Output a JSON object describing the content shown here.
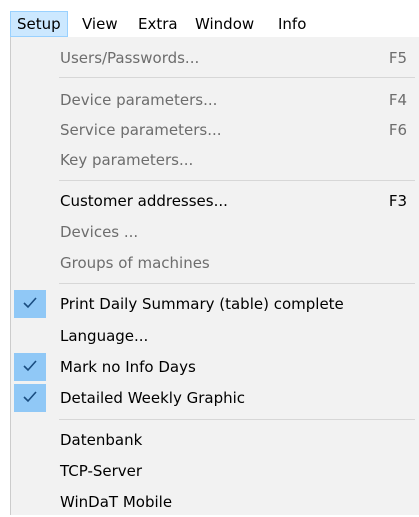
{
  "menubar": {
    "items": [
      "Setup",
      "View",
      "Extra",
      "Window",
      "Info"
    ]
  },
  "menu": {
    "users_passwords": {
      "label": "Users/Passwords...",
      "shortcut": "F5"
    },
    "device_parameters": {
      "label": "Device parameters...",
      "shortcut": "F4"
    },
    "service_parameters": {
      "label": "Service parameters...",
      "shortcut": "F6"
    },
    "key_parameters": {
      "label": "Key parameters..."
    },
    "customer_addresses": {
      "label": "Customer addresses...",
      "shortcut": "F3"
    },
    "devices": {
      "label": "Devices ..."
    },
    "groups_of_machines": {
      "label": "Groups of machines"
    },
    "print_daily_summary": {
      "label": "Print Daily Summary (table) complete",
      "checked": true
    },
    "language": {
      "label": "Language..."
    },
    "mark_no_info_days": {
      "label": "Mark no Info Days",
      "checked": true
    },
    "detailed_weekly_graphic": {
      "label": "Detailed Weekly Graphic",
      "checked": true
    },
    "datenbank": {
      "label": "Datenbank"
    },
    "tcp_server": {
      "label": "TCP-Server"
    },
    "windat_mobile": {
      "label": "WinDaT Mobile"
    }
  },
  "colors": {
    "menu_background": "#f2f2f2",
    "active_menubar_highlight": "#cce8ff",
    "check_highlight": "#90c8f6",
    "disabled_text": "#6d6d6d"
  },
  "icons": {
    "check": "checkmark-icon"
  }
}
